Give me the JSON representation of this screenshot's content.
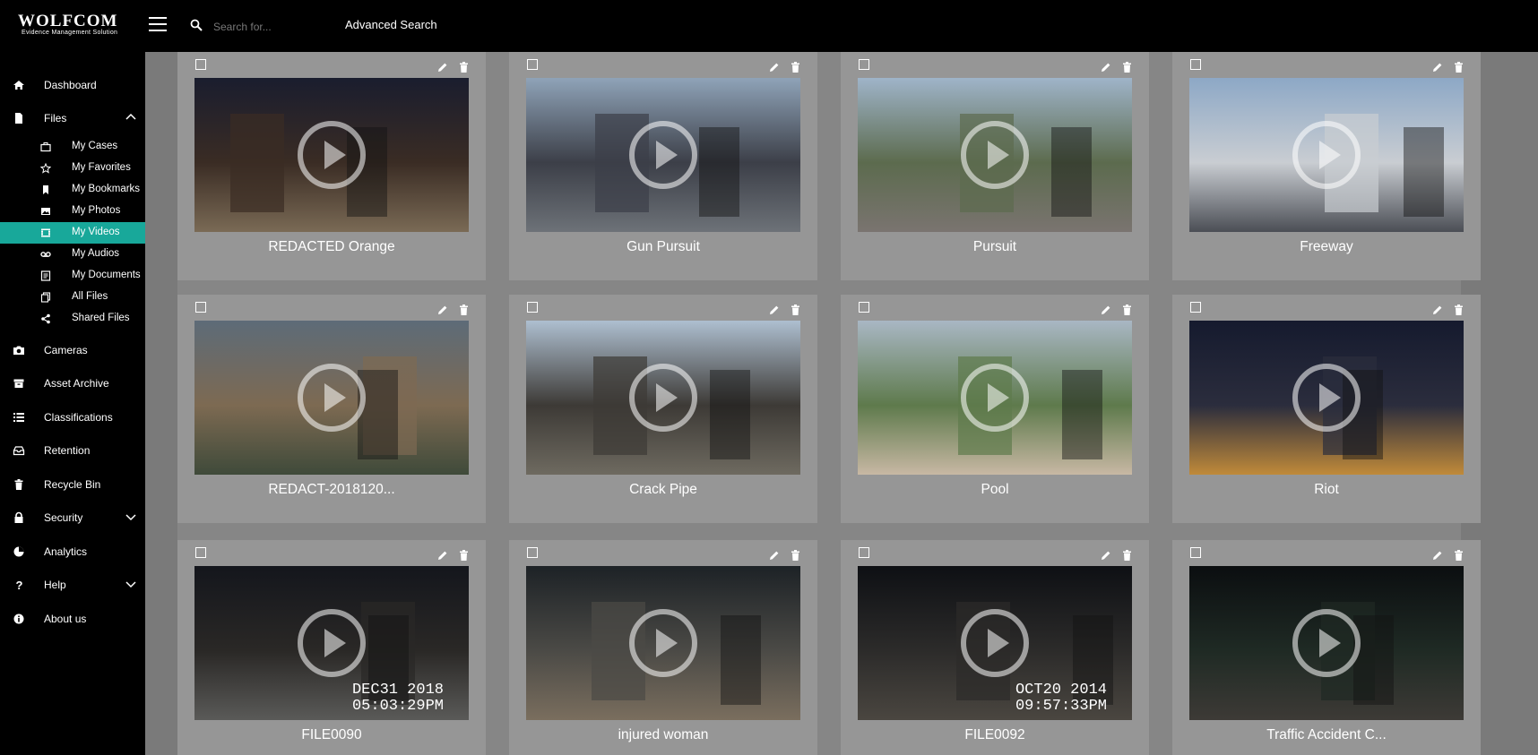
{
  "brand": {
    "name": "WOLFCOM",
    "tagline": "Evidence Management Solution"
  },
  "search": {
    "placeholder": "Search for...",
    "advanced_label": "Advanced Search"
  },
  "sidebar": {
    "items": [
      {
        "label": "Dashboard",
        "icon": "home-icon"
      },
      {
        "label": "Files",
        "icon": "file-icon",
        "expanded": true
      },
      {
        "label": "Cameras",
        "icon": "camera-icon"
      },
      {
        "label": "Asset Archive",
        "icon": "archive-icon"
      },
      {
        "label": "Classifications",
        "icon": "list-icon"
      },
      {
        "label": "Retention",
        "icon": "inbox-icon"
      },
      {
        "label": "Recycle Bin",
        "icon": "trash-icon"
      },
      {
        "label": "Security",
        "icon": "lock-icon"
      },
      {
        "label": "Analytics",
        "icon": "pie-chart-icon"
      },
      {
        "label": "Help",
        "icon": "question-icon"
      },
      {
        "label": "About us",
        "icon": "info-icon"
      }
    ],
    "files_sub": [
      {
        "label": "My Cases",
        "icon": "briefcase-icon"
      },
      {
        "label": "My Favorites",
        "icon": "star-icon"
      },
      {
        "label": "My Bookmarks",
        "icon": "bookmark-icon"
      },
      {
        "label": "My Photos",
        "icon": "image-icon"
      },
      {
        "label": "My Videos",
        "icon": "film-icon",
        "active": true
      },
      {
        "label": "My Audios",
        "icon": "tape-icon"
      },
      {
        "label": "My Documents",
        "icon": "document-icon"
      },
      {
        "label": "All Files",
        "icon": "copy-icon"
      },
      {
        "label": "Shared Files",
        "icon": "share-icon"
      }
    ]
  },
  "colors": {
    "accent": "#18a89a",
    "bar": "#000000",
    "card": "#969696"
  },
  "videos": [
    {
      "title": "REDACTED Orange"
    },
    {
      "title": "Gun Pursuit"
    },
    {
      "title": "Pursuit"
    },
    {
      "title": "Freeway"
    },
    {
      "title": "REDACT-2018120..."
    },
    {
      "title": "Crack Pipe"
    },
    {
      "title": "Pool"
    },
    {
      "title": "Riot"
    },
    {
      "title": "FILE0090",
      "stamp": [
        "DEC31 2018",
        "05:03:29PM"
      ]
    },
    {
      "title": "injured woman"
    },
    {
      "title": "FILE0092",
      "stamp": [
        "OCT20 2014",
        "09:57:33PM"
      ]
    },
    {
      "title": "Traffic Accident C..."
    }
  ]
}
